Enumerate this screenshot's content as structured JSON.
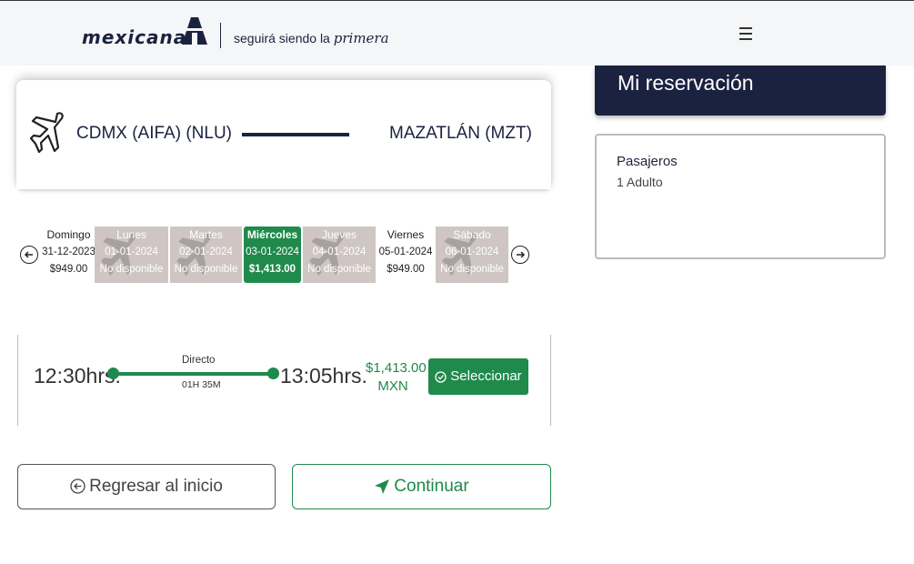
{
  "header": {
    "brand": "mexicana",
    "tagline_prefix": "seguirá siendo la",
    "tagline_script": "primera",
    "menu_icon": "hamburger-menu-icon"
  },
  "route": {
    "plane_icon": "plane-icon",
    "origin": "CDMX (AIFA) (NLU)",
    "destination": "MAZATLÁN (MZT)"
  },
  "date_carousel": {
    "prev_icon": "arrow-left-circle-icon",
    "next_icon": "arrow-right-circle-icon",
    "days": [
      {
        "name": "Domingo",
        "date": "31-12-2023",
        "price": "$949.00",
        "status": "available"
      },
      {
        "name": "Lunes",
        "date": "01-01-2024",
        "price": "No disponible",
        "status": "unavailable"
      },
      {
        "name": "Martes",
        "date": "02-01-2024",
        "price": "No disponible",
        "status": "unavailable"
      },
      {
        "name": "Miércoles",
        "date": "03-01-2024",
        "price": "$1,413.00",
        "status": "selected"
      },
      {
        "name": "Jueves",
        "date": "04-01-2024",
        "price": "No disponible",
        "status": "unavailable"
      },
      {
        "name": "Viernes",
        "date": "05-01-2024",
        "price": "$949.00",
        "status": "available"
      },
      {
        "name": "Sábado",
        "date": "06-01-2024",
        "price": "No disponible",
        "status": "unavailable"
      }
    ]
  },
  "flight": {
    "departure": "12:30hrs.",
    "arrival": "13:05hrs.",
    "type": "Directo",
    "duration": "01H 35M",
    "price_amount": "$1,413.00",
    "price_currency": "MXN",
    "select_label": "Seleccionar"
  },
  "actions": {
    "back_label": "Regresar al inicio",
    "continue_label": "Continuar"
  },
  "sidebar": {
    "title": "Mi reservación",
    "passengers_label": "Pasajeros",
    "passengers_value": "1 Adulto"
  },
  "colors": {
    "navy": "#1b2240",
    "green": "#1f8a4c",
    "unavailable": "#cfc6c4"
  }
}
